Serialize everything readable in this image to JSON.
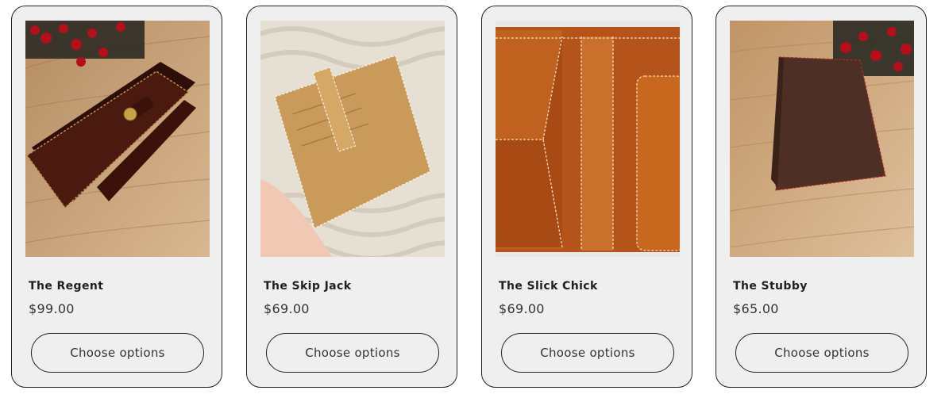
{
  "products": [
    {
      "title": "The Regent",
      "price": "$99.00",
      "button_label": "Choose options",
      "image": "dark-brown-long-wallet-with-snap-on-wood",
      "colors": {
        "leather": "#4a1a10",
        "background": "#c9a47a"
      }
    },
    {
      "title": "The Skip Jack",
      "price": "$69.00",
      "button_label": "Choose options",
      "image": "tan-card-holder-in-hand",
      "colors": {
        "leather": "#c99a5a",
        "background": "#e8e2d8"
      }
    },
    {
      "title": "The Slick Chick",
      "price": "$69.00",
      "button_label": "Choose options",
      "image": "open-orange-leather-wallet-interior",
      "colors": {
        "leather": "#c0621f",
        "background": "#b4531a"
      }
    },
    {
      "title": "The Stubby",
      "price": "$65.00",
      "button_label": "Choose options",
      "image": "dark-brown-passport-wallet-on-wood",
      "colors": {
        "leather": "#4d2f25",
        "background": "#d0ad82"
      }
    }
  ]
}
